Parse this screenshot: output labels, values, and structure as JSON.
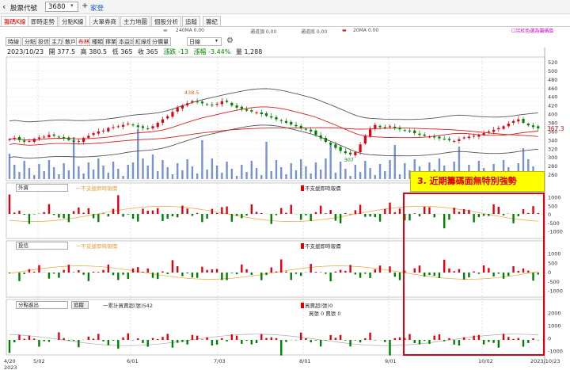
{
  "titlebar": {
    "back_icon": "chevron-left-icon",
    "label": "股票代號",
    "symbol": "3680",
    "add_icon": "plus-icon",
    "stock_name": "家登"
  },
  "tabs": [
    "籌碼K線",
    "即時走勢",
    "分點K線",
    "大單券商",
    "主力地圖",
    "個股分析",
    "追蹤",
    "籌紀"
  ],
  "controls": {
    "ma240": "240MA 0.00",
    "upper": "通道頂 0.00",
    "lower": "通道底 0.00",
    "ma20": "20MA 0.00",
    "chip_option": "☐另紅色選為籌碼區"
  },
  "periods": [
    "時線",
    "分點",
    "投信",
    "主力",
    "散戶",
    "布林",
    "種類",
    "擇業",
    "本益比",
    "紅綠燈",
    "分價量"
  ],
  "interval": "日線",
  "quote": {
    "date": "2023/10/23",
    "open": "開 377.5",
    "high": "高 380.5",
    "low": "低 365",
    "close": "收 365",
    "change": "漲跌 -13",
    "pct": "漲幅 -3.44%",
    "volume": "量 1,288"
  },
  "price_labels": {
    "high": "438.5",
    "low": "307",
    "current": "367.3"
  },
  "price_axis": [
    520,
    500,
    480,
    460,
    440,
    420,
    400,
    380,
    360,
    340,
    320,
    300,
    280,
    260
  ],
  "panel2": {
    "select": "外資",
    "line_legend": "一不支援即時報價",
    "bar_legend": "不支援即時報價",
    "axis": [
      1000,
      500,
      0,
      -500,
      -1000
    ]
  },
  "panel3": {
    "select": "投信",
    "line_legend": "一不支援即時報價",
    "bar_legend": "不支援即時報價",
    "axis": [
      1000,
      500,
      0,
      -500,
      -1000
    ]
  },
  "panel4": {
    "select": "分點進出",
    "button": "追蹤",
    "line_legend": "一累計買賣超(張)542",
    "bar_legend": "買賣超(張)0",
    "bar_legend2": "買張 0 賣張 0",
    "axis": [
      2000,
      1000,
      0,
      -1000
    ]
  },
  "x_axis": {
    "year": "2023",
    "labels": [
      "4/20",
      "5/02",
      "6/01",
      "7/03",
      "8/01",
      "9/01",
      "10/02",
      "2023/10/23"
    ]
  },
  "annotation": "3. 近期籌碼面無特別強勢",
  "colors": {
    "up": "#e00010",
    "down": "#008000",
    "volume": "#4a6fbf",
    "ma_red": "#d42020",
    "bollinger": "#555555",
    "institutional_line": "#f0a030",
    "highlight_box": "#e00010",
    "annotation_bg": "#ffff00"
  },
  "chart_data": [
    {
      "type": "candlestick",
      "title": "",
      "ylim": [
        250,
        530
      ],
      "ohlc_close": [
        342,
        345,
        340,
        336,
        338,
        343,
        346,
        348,
        352,
        350,
        347,
        344,
        340,
        336,
        338,
        345,
        350,
        356,
        360,
        362,
        368,
        370,
        372,
        375,
        378,
        374,
        370,
        368,
        366,
        372,
        380,
        388,
        395,
        405,
        415,
        420,
        425,
        430,
        428,
        425,
        422,
        420,
        424,
        430,
        428,
        420,
        415,
        412,
        408,
        406,
        404,
        400,
        396,
        392,
        388,
        384,
        380,
        376,
        372,
        368,
        364,
        360,
        352,
        344,
        336,
        330,
        322,
        315,
        310,
        307,
        312,
        330,
        350,
        365,
        375,
        370,
        368,
        372,
        368,
        365,
        362,
        360,
        356,
        352,
        350,
        348,
        346,
        344,
        342,
        340,
        338,
        342,
        346,
        348,
        350,
        352,
        356,
        360,
        364,
        368,
        372,
        378,
        384,
        388,
        380,
        374,
        370,
        367
      ]
    },
    {
      "type": "bar",
      "title": "外資",
      "ylim": [
        -1000,
        1000
      ]
    },
    {
      "type": "bar",
      "title": "投信",
      "ylim": [
        -1000,
        1000
      ]
    },
    {
      "type": "bar",
      "title": "分點進出",
      "ylim": [
        -1500,
        2500
      ]
    }
  ]
}
